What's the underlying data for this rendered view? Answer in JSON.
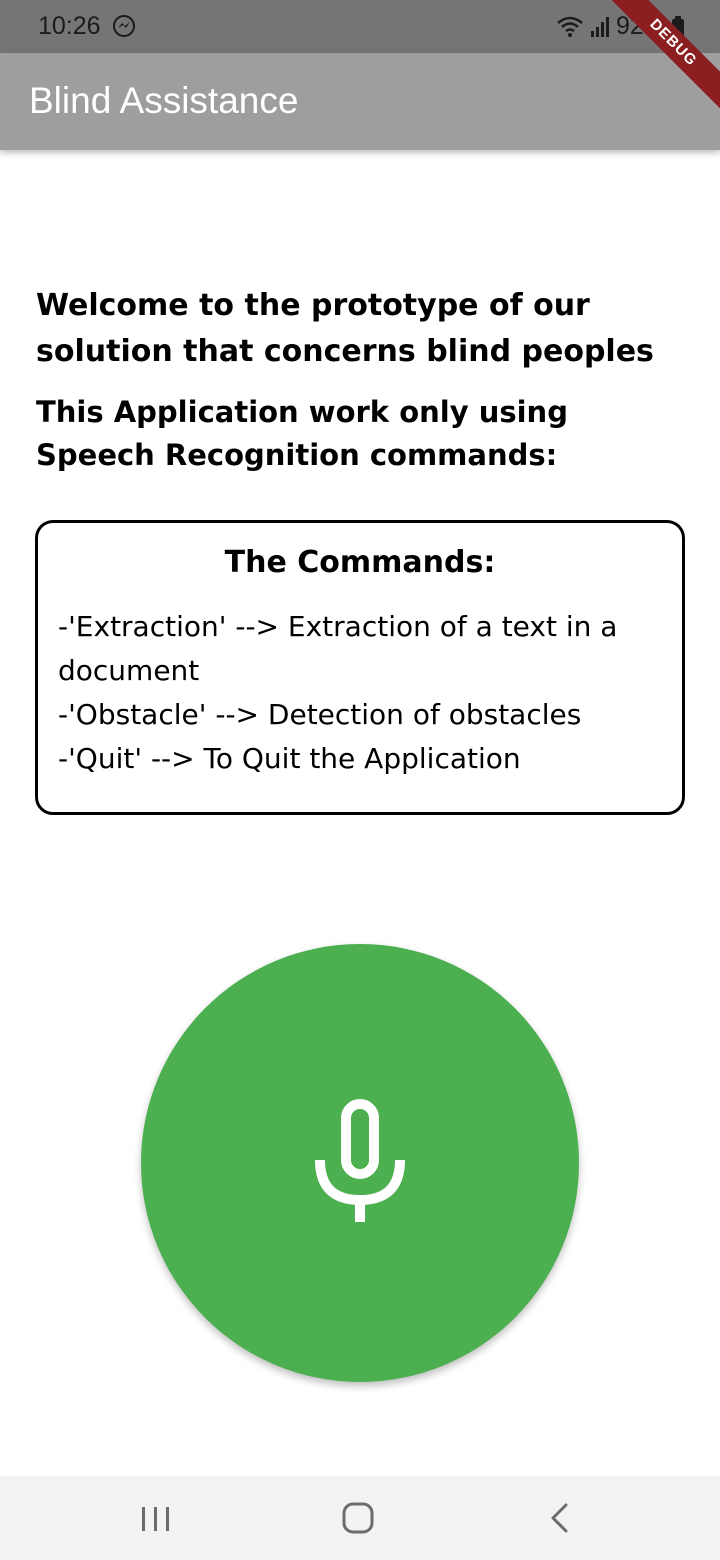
{
  "status_bar": {
    "time": "10:26",
    "battery": "92%",
    "icons": [
      "messenger-icon",
      "wifi-icon",
      "signal-icon",
      "battery-icon"
    ]
  },
  "debug_banner": "DEBUG",
  "app_bar": {
    "title": "Blind Assistance",
    "background_color": "#9e9e9e"
  },
  "content": {
    "welcome": "Welcome to the prototype of our solution that concerns blind peoples",
    "info": "This Application work only using Speech Recognition commands:",
    "commands": {
      "title": "The Commands:",
      "items": [
        "-'Extraction' --> Extraction of a text in a document",
        "-'Obstacle' --> Detection of obstacles",
        "-'Quit' --> To Quit the Application"
      ]
    }
  },
  "mic_button": {
    "icon": "microphone-icon",
    "color": "#4caf50"
  },
  "nav_bar": {
    "icons": [
      "recents-icon",
      "home-icon",
      "back-icon"
    ]
  }
}
